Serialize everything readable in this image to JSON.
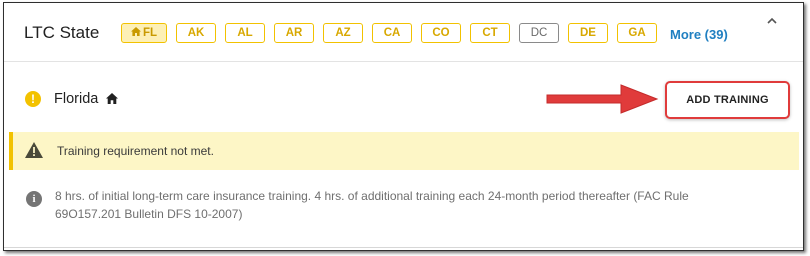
{
  "header": {
    "title": "LTC State",
    "states": [
      {
        "code": "FL",
        "active": true,
        "home": true
      },
      {
        "code": "AK"
      },
      {
        "code": "AL"
      },
      {
        "code": "AR"
      },
      {
        "code": "AZ"
      },
      {
        "code": "CA"
      },
      {
        "code": "CO"
      },
      {
        "code": "CT"
      },
      {
        "code": "DC",
        "gray": true
      },
      {
        "code": "DE"
      },
      {
        "code": "GA"
      }
    ],
    "more_label": "More (39)"
  },
  "state_row": {
    "name": "Florida",
    "add_training_label": "ADD TRAINING"
  },
  "banner": {
    "text": "Training requirement not met."
  },
  "info": {
    "text": "8 hrs. of initial long-term care insurance training. 4 hrs. of additional training each 24-month period thereafter (FAC Rule 69O157.201 Bulletin DFS 10-2007)"
  },
  "colors": {
    "accent": "#1f7fc1",
    "warning": "#f2c200",
    "annotation_red": "#e03b3b"
  }
}
